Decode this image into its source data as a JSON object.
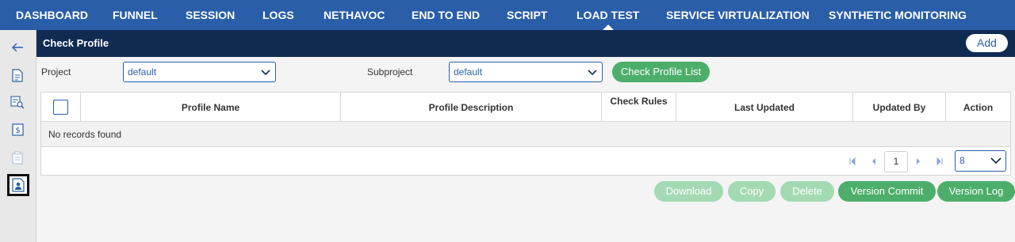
{
  "nav": {
    "items": [
      {
        "label": "DASHBOARD"
      },
      {
        "label": "FUNNEL"
      },
      {
        "label": "SESSION"
      },
      {
        "label": "LOGS"
      },
      {
        "label": "NETHAVOC"
      },
      {
        "label": "END TO END"
      },
      {
        "label": "SCRIPT"
      },
      {
        "label": "LOAD TEST"
      },
      {
        "label": "SERVICE VIRTUALIZATION"
      },
      {
        "label": "SYNTHETIC MONITORING"
      }
    ],
    "active": "LOAD TEST"
  },
  "sidebar": {
    "icons": [
      "back-arrow-icon",
      "document-icon",
      "search-report-icon",
      "dollar-doc-icon",
      "clipboard-icon",
      "profile-doc-icon"
    ]
  },
  "header": {
    "title": "Check Profile",
    "add_label": "Add"
  },
  "filters": {
    "project_label": "Project",
    "project_value": "default",
    "subproject_label": "Subproject",
    "subproject_value": "default",
    "list_button": "Check Profile List"
  },
  "table": {
    "columns": [
      "Profile Name",
      "Profile Description",
      "Check Rules",
      "Last Updated",
      "Updated By",
      "Action"
    ],
    "empty_text": "No records found",
    "page": "1",
    "rows_per_page": "8"
  },
  "actions": {
    "download": "Download",
    "copy": "Copy",
    "delete": "Delete",
    "version_commit": "Version Commit",
    "version_log": "Version Log"
  },
  "colors": {
    "nav_bg": "#2a5ea8",
    "header_bg": "#0f2b52",
    "green": "#4cae6a",
    "green_disabled": "#a3d9b3"
  }
}
